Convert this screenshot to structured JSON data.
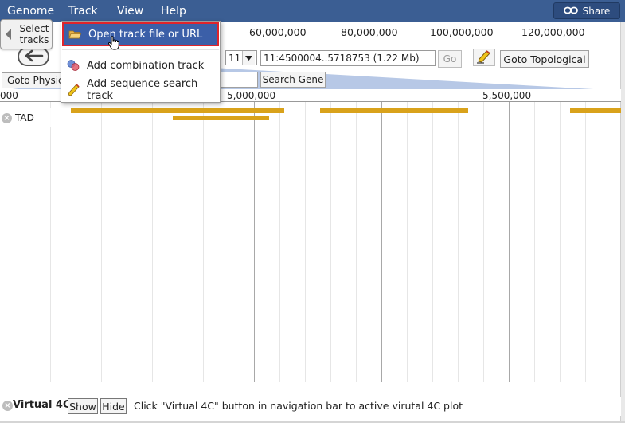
{
  "menubar": {
    "items": [
      "Genome",
      "Track",
      "View",
      "Help"
    ],
    "share_label": "Share",
    "background": "#3b5e93"
  },
  "overview": {
    "select_tracks_label": "Select tracks",
    "ticks": [
      "60,000,000",
      "80,000,000",
      "100,000,000",
      "120,000,000"
    ]
  },
  "navigation": {
    "chromosome": "11",
    "locus": "11:4500004..5718753 (1.22 Mb)",
    "go_label": "Go",
    "goto_topological_label": "Goto Topological",
    "goto_physical_label": "Goto Physical",
    "search_gene_label": "Search Gene"
  },
  "ruler": {
    "labels": [
      "000",
      "5,000,000",
      "5,500,000"
    ]
  },
  "tracks": [
    {
      "label": "TAD",
      "color": "#d9a21b"
    }
  ],
  "track_menu": {
    "items": [
      {
        "label": "Open track file or URL",
        "icon": "folder-open-icon",
        "active": true
      },
      {
        "label": "Add combination track",
        "icon": "combination-icon",
        "active": false
      },
      {
        "label": "Add sequence search track",
        "icon": "sequence-search-icon",
        "active": false
      }
    ]
  },
  "virtual4c": {
    "title": "Virtual 4C",
    "show_label": "Show",
    "hide_label": "Hide",
    "hint": "Click \"Virtual 4C\" button in navigation bar to active virutal 4C plot"
  }
}
